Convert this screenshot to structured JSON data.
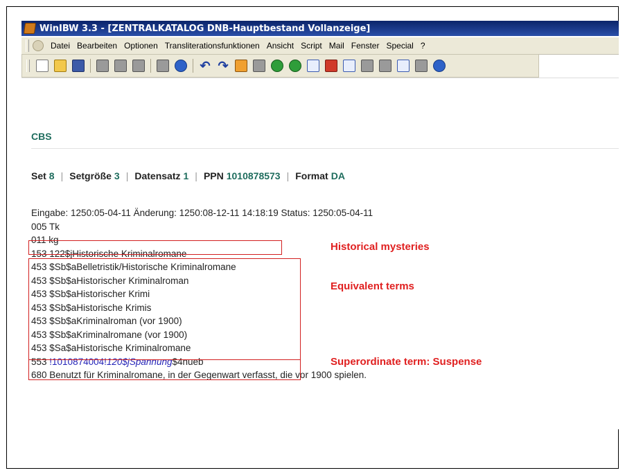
{
  "window": {
    "title": "WinIBW 3.3 - [ZENTRALKATALOG DNB-Hauptbestand Vollanzeige]"
  },
  "menu": {
    "items": [
      "Datei",
      "Bearbeiten",
      "Optionen",
      "Transliterationsfunktionen",
      "Ansicht",
      "Script",
      "Mail",
      "Fenster",
      "Special",
      "?"
    ]
  },
  "toolbar": {
    "icons": [
      "new-document",
      "open-folder",
      "save",
      "cut",
      "copy",
      "paste",
      "print",
      "help",
      "undo",
      "redo",
      "home",
      "bookmark",
      "back",
      "forward",
      "list-view",
      "list-red",
      "index",
      "tree",
      "book",
      "help-box",
      "book-dark",
      "up"
    ]
  },
  "header": {
    "system": "CBS"
  },
  "set_info": {
    "set_label": "Set",
    "set_value": "8",
    "setsize_label": "Setgröße",
    "setsize_value": "3",
    "record_label": "Datensatz",
    "record_value": "1",
    "ppn_label": "PPN",
    "ppn_value": "1010878573",
    "format_label": "Format",
    "format_value": "DA"
  },
  "record": {
    "line1": "Eingabe: 1250:05-04-11 Änderung: 1250:08-12-11 14:18:19 Status: 1250:05-04-11",
    "line2": "005 Tk",
    "line3": "011 kg",
    "line4": "153 122$jHistorische Kriminalromane",
    "line5": "453 $Sb$aBelletristik/Historische Kriminalromane",
    "line6": "453 $Sb$aHistorischer Kriminalroman",
    "line7": "453 $Sb$aHistorischer Krimi",
    "line8": "453 $Sb$aHistorische Krimis",
    "line9": "453 $Sb$aKriminalroman (vor 1900)",
    "line10": "453 $Sb$aKriminalromane (vor 1900)",
    "line11": "453 $Sa$aHistorische Kriminalromane",
    "line12_prefix": "553 ",
    "line12_link": "!1010874004!",
    "line12_italic": "120$jSpannung",
    "line12_suffix": "$4nueb",
    "line13": "680 Benutzt für Kriminalromane, in der Gegenwart verfasst, die vor 1900 spielen."
  },
  "annotations": {
    "a1": "Historical mysteries",
    "a2": "Equivalent terms",
    "a3": "Superordinate term: Suspense"
  },
  "colors": {
    "annotation": "#e02020",
    "accent": "#1f6d5e",
    "link": "#2424b8"
  }
}
